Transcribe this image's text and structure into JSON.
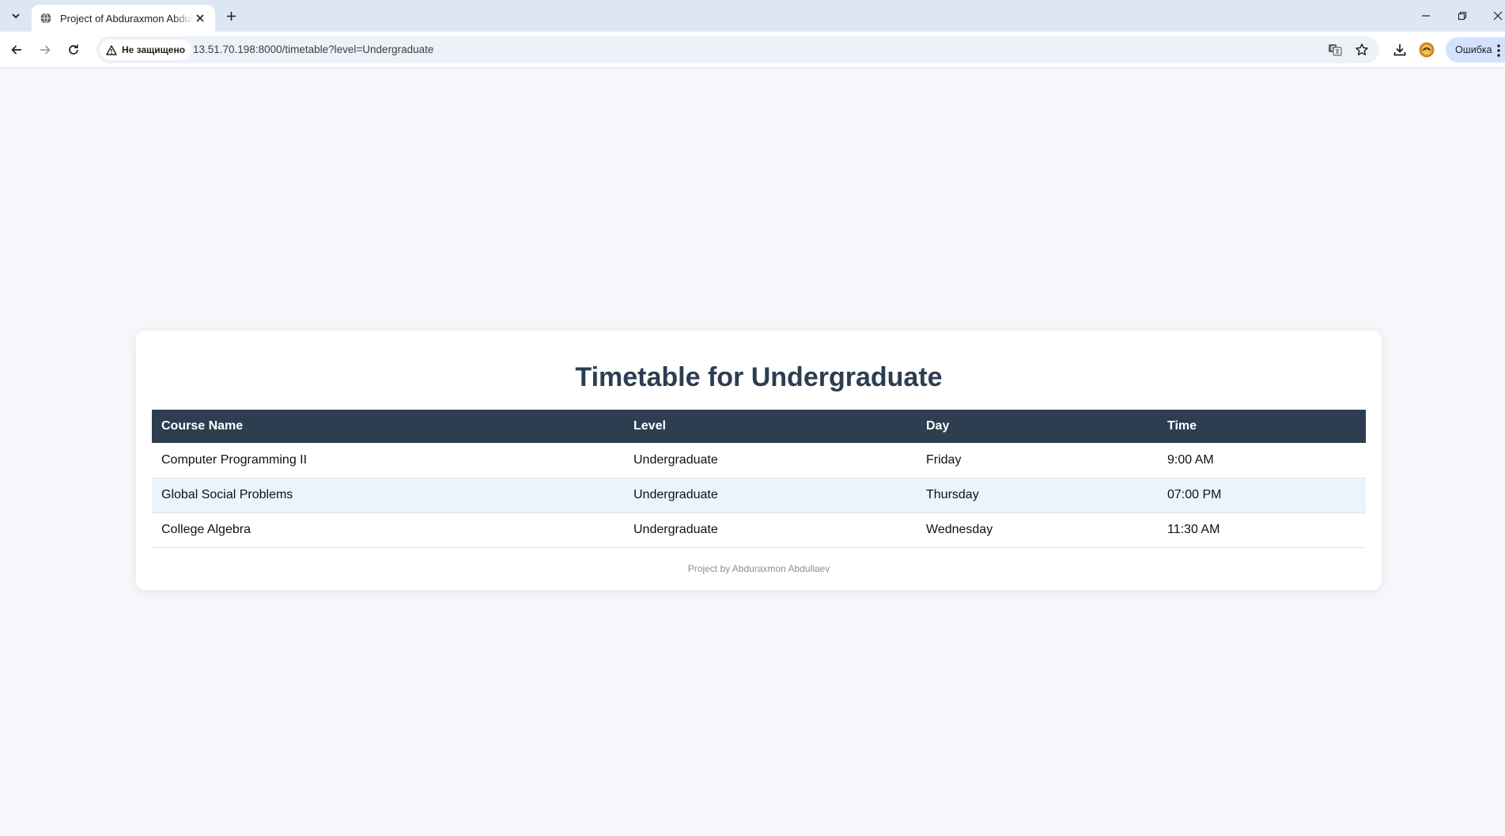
{
  "browser": {
    "tab": {
      "title": "Project of Abduraxmon Abdullaev"
    },
    "address_bar": {
      "security_label": "Не защищено",
      "url": "13.51.70.198:8000/timetable?level=Undergraduate"
    },
    "profile": {
      "label": "Ошибка"
    }
  },
  "page": {
    "title": "Timetable for Undergraduate",
    "table": {
      "headers": [
        "Course Name",
        "Level",
        "Day",
        "Time"
      ],
      "rows": [
        [
          "Computer Programming II",
          "Undergraduate",
          "Friday",
          "9:00 AM"
        ],
        [
          "Global Social Problems",
          "Undergraduate",
          "Thursday",
          "07:00 PM"
        ],
        [
          "College Algebra",
          "Undergraduate",
          "Wednesday",
          "11:30 AM"
        ]
      ]
    },
    "footer": "Project by Abduraxmon Abdullaev"
  },
  "colors": {
    "header_bg": "#2c3e50",
    "title_text": "#2c3e50",
    "alt_row_bg": "#eaf4fd",
    "page_bg": "#f5f7fa"
  },
  "icons": {
    "tab_favicon": "globe-icon",
    "security": "warning-triangle-icon",
    "translate": "translate-icon",
    "bookmark": "star-icon",
    "download": "download-icon",
    "extension": "extension-avatar-icon"
  }
}
